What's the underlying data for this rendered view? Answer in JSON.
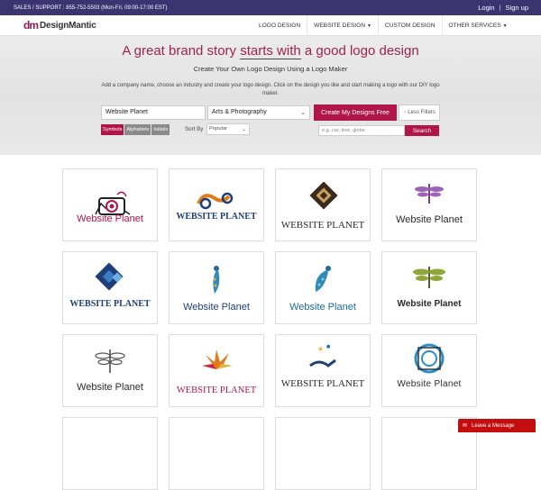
{
  "topbar": {
    "support": "SALES / SUPPORT : 855-752-5503 (Mon-Fri, 09:00-17:00 EST)",
    "login": "Login",
    "signup": "Sign up"
  },
  "nav": {
    "logo_mark": "dm",
    "logo_text": "DesignMantic",
    "items": [
      "LOGO DESIGN",
      "WEBSITE DESIGN",
      "CUSTOM DESIGN",
      "OTHER SERVICES"
    ]
  },
  "hero": {
    "title_a": "A great brand story ",
    "title_b": "starts with",
    "title_c": " a good logo design",
    "subtitle": "Create Your Own Logo Design Using a Logo Maker",
    "description": "Add a company name, choose an industry and create your logo design. Click on the design you like and start making a logo with our DIY logo maker.",
    "company_value": "Website Planet",
    "industry_value": "Arts & Photography",
    "create_button": "Create My Designs Free",
    "filters_button": "Less Filters",
    "tabs": [
      "Symbols",
      "Alphabets",
      "Initials"
    ],
    "sort_label": "Sort By",
    "sort_value": "Popular",
    "keyword_placeholder": "e.g. car, tree, globe",
    "search_button": "Search"
  },
  "cards": [
    {
      "label": "Website Planet",
      "icon": "camera-icon",
      "color": "#b0154a"
    },
    {
      "label": "WEBSITE PLANET",
      "icon": "swirl-icon",
      "color": "#1e3f77"
    },
    {
      "label": "WEBSITE PLANET",
      "icon": "diamond-tile-icon",
      "color": "#2a2a2a"
    },
    {
      "label": "Website Planet",
      "icon": "dragonfly-icon",
      "color": "#2a2a2a"
    },
    {
      "label": "WEBSITE PLANET",
      "icon": "pixel-diamond-icon",
      "color": "#1e3f77"
    },
    {
      "label": "Website Planet",
      "icon": "peacock-icon",
      "color": "#1e3f77"
    },
    {
      "label": "Website Planet",
      "icon": "peacock-icon",
      "color": "#1e6b9a"
    },
    {
      "label": "Website Planet",
      "icon": "dragonfly-icon",
      "color": "#2a2a2a"
    },
    {
      "label": "Website Planet",
      "icon": "dragonfly-icon",
      "color": "#2a2a2a"
    },
    {
      "label": "WEBSITE PLANET",
      "icon": "leaf-burst-icon",
      "color": "#b0154a"
    },
    {
      "label": "WEBSITE PLANET",
      "icon": "hand-stars-icon",
      "color": "#2a2a2a"
    },
    {
      "label": "Website Planet",
      "icon": "aperture-icon",
      "color": "#2a2a2a"
    }
  ],
  "chat": {
    "label": "Leave a Message"
  }
}
